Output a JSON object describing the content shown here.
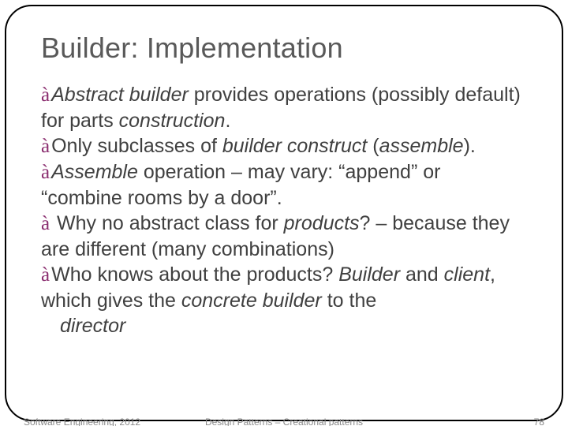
{
  "title": "Builder: Implementation",
  "items": {
    "i1": {
      "a": "Abstract builder",
      "b": " provides operations (possibly default) for parts ",
      "c": "construction",
      "d": "."
    },
    "i2": {
      "a": "Only subclasses of ",
      "b": "builder construct",
      "c": " (",
      "d": "assemble",
      "e": ")."
    },
    "i3": {
      "a": "Assemble",
      "b": " operation – may vary: ",
      "c": "“",
      "d": "append",
      "e": "”",
      "f": " or ",
      "g": "“",
      "h": "combine rooms by a door",
      "i": "”",
      "j": "."
    },
    "i4": {
      "a": " Why no abstract class for ",
      "b": "products",
      "c": "? – because they are different (many combinations)"
    },
    "i5": {
      "a": "Who knows about the products? ",
      "b": "Builder",
      "c": " and ",
      "d": "client",
      "e": ", which gives the ",
      "f": "concrete builder",
      "g": " to the"
    },
    "i6": "director"
  },
  "footer": {
    "left": "Software Engineering, 2012",
    "center": "Design Patterns – Creational patterns",
    "right": "78"
  }
}
